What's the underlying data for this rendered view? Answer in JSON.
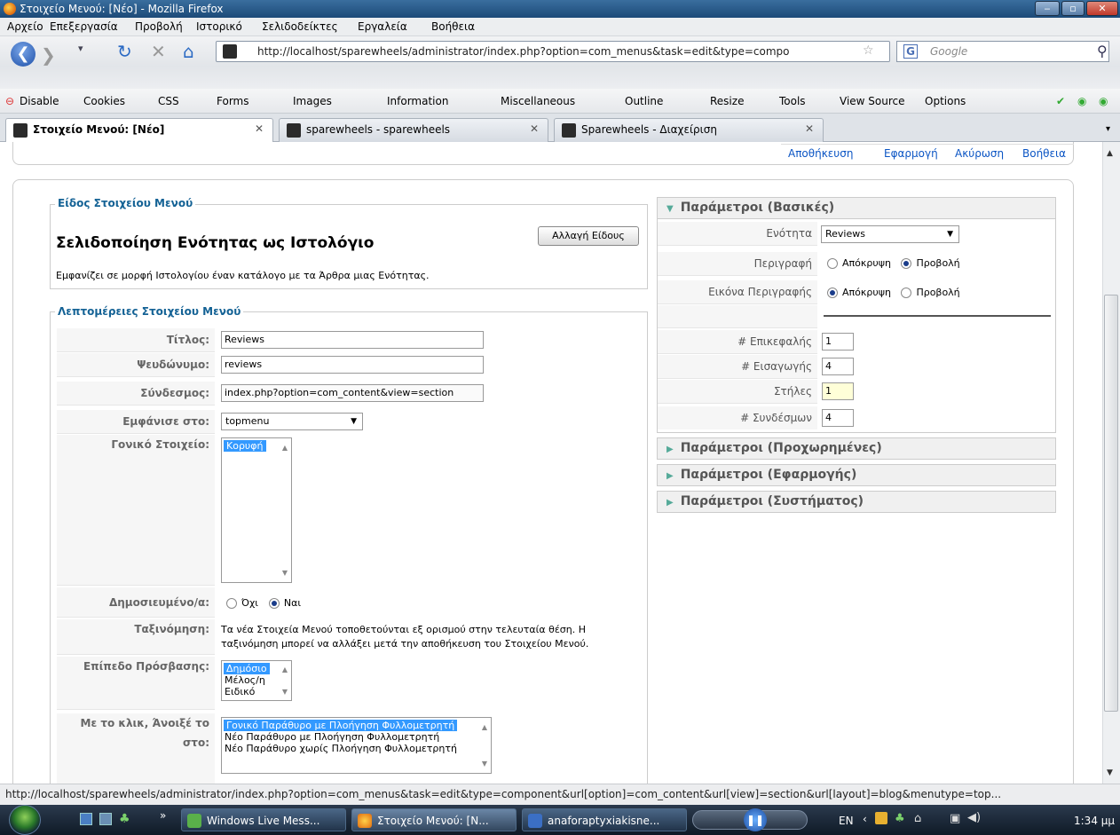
{
  "window": {
    "title": "Στοιχείο Μενού: [Νέο] - Mozilla Firefox"
  },
  "menubar": [
    "Αρχείο",
    "Επεξεργασία",
    "Προβολή",
    "Ιστορικό",
    "Σελιδοδείκτες",
    "Εργαλεία",
    "Βοήθεια"
  ],
  "address": {
    "url": "http://localhost/sparewheels/administrator/index.php?option=com_menus&task=edit&type=compo",
    "search_placeholder": "Google"
  },
  "devbar": [
    "Disable",
    "Cookies",
    "CSS",
    "Forms",
    "Images",
    "Information",
    "Miscellaneous",
    "Outline",
    "Resize",
    "Tools",
    "View Source",
    "Options"
  ],
  "tabs": [
    {
      "label": "Στοιχείο Μενού: [Νέο]"
    },
    {
      "label": "sparewheels - sparewheels"
    },
    {
      "label": "Sparewheels - Διαχείριση"
    }
  ],
  "toolbar": {
    "save": "Αποθήκευση",
    "apply": "Εφαρμογή",
    "cancel": "Ακύρωση",
    "help": "Βοήθεια"
  },
  "type_section": {
    "legend": "Είδος Στοιχείου Μενού",
    "change_button": "Αλλαγή Είδους",
    "heading": "Σελιδοποίηση Ενότητας ως Ιστολόγιο",
    "description": "Εμφανίζει σε μορφή Ιστολογίου έναν κατάλογο με τα Άρθρα μιας Ενότητας."
  },
  "details": {
    "legend": "Λεπτομέρειες Στοιχείου Μενού",
    "title_label": "Τίτλος:",
    "title_value": "Reviews",
    "alias_label": "Ψευδώνυμο:",
    "alias_value": "reviews",
    "link_label": "Σύνδεσμος:",
    "link_value": "index.php?option=com_content&view=section",
    "display_label": "Εμφάνισε στο:",
    "display_value": "topmenu",
    "parent_label": "Γονικό Στοιχείο:",
    "parent_options": [
      "Κορυφή"
    ],
    "published_label": "Δημοσιευμένο/α:",
    "published_no": "Όχι",
    "published_yes": "Ναι",
    "order_label": "Ταξινόμηση:",
    "order_text1": "Τα νέα Στοιχεία Μενού τοποθετούνται εξ ορισμού στην τελευταία θέση. Η",
    "order_text2": "ταξινόμηση μπορεί να αλλάξει μετά την αποθήκευση του Στοιχείου Μενού.",
    "access_label": "Επίπεδο Πρόσβασης:",
    "access_options": [
      "Δημόσιο",
      "Μέλος/η",
      "Ειδικό"
    ],
    "onclick_label": "Με το κλικ, Άνοιξέ το στο:",
    "onclick_options": [
      "Γονικό Παράθυρο με Πλοήγηση Φυλλομετρητή",
      "Νέο Παράθυρο με Πλοήγηση Φυλλομετρητή",
      "Νέο Παράθυρο χωρίς Πλοήγηση Φυλλομετρητή"
    ]
  },
  "params": {
    "basic_title": "Παράμετροι (Βασικές)",
    "section_label": "Ενότητα",
    "section_value": "Reviews",
    "description_label": "Περιγραφή",
    "hide": "Απόκρυψη",
    "show": "Προβολή",
    "desc_image_label": "Εικόνα Περιγραφής",
    "leading_label": "# Επικεφαλής",
    "leading_value": "1",
    "intro_label": "# Εισαγωγής",
    "intro_value": "4",
    "columns_label": "Στήλες",
    "columns_value": "1",
    "links_label": "# Συνδέσμων",
    "links_value": "4",
    "advanced_title": "Παράμετροι (Προχωρημένες)",
    "component_title": "Παράμετροι (Εφαρμογής)",
    "system_title": "Παράμετροι (Συστήματος)"
  },
  "status": "http://localhost/sparewheels/administrator/index.php?option=com_menus&task=edit&type=component&url[option]=com_content&url[view]=section&url[layout]=blog&menutype=top...",
  "taskbar": {
    "items": [
      "Windows Live Mess...",
      "Στοιχείο Μενού: [Ν...",
      "anaforaptyxiakisne..."
    ],
    "lang": "EN",
    "clock": "1:34 μμ"
  },
  "colors": {
    "link": "#0b55c4",
    "legend": "#146295",
    "selection": "#3399ff"
  }
}
